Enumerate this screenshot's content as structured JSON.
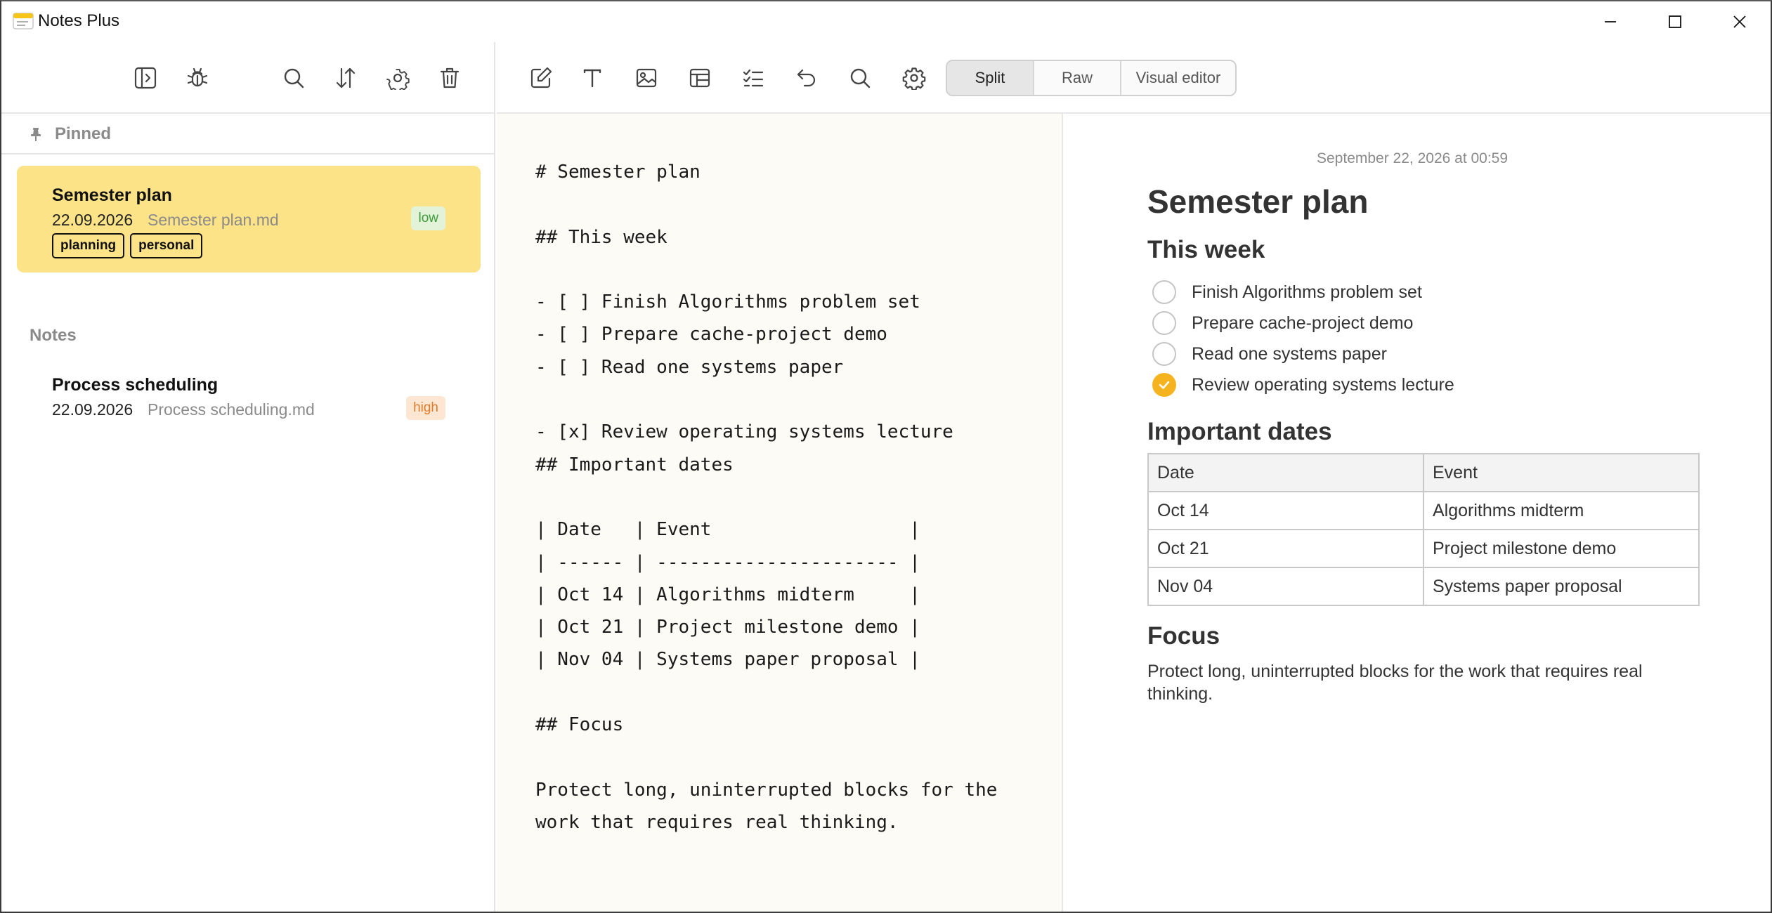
{
  "window": {
    "title": "Notes Plus",
    "controls": {
      "minimize_icon": "minimize-icon",
      "maximize_icon": "maximize-icon",
      "close_icon": "close-icon"
    }
  },
  "sidebar": {
    "toolbar_icons": [
      "toggle-sidebar-icon",
      "bug-icon",
      "search-icon",
      "sort-icon",
      "settings-icon",
      "trash-icon"
    ],
    "pinned_label": "Pinned",
    "pinned_notes": [
      {
        "title": "Semester plan",
        "date": "22.09.2026",
        "file": "Semester plan.md",
        "priority": "low",
        "tags": [
          "planning",
          "personal"
        ]
      }
    ],
    "notes_label": "Notes",
    "notes": [
      {
        "title": "Process scheduling",
        "date": "22.09.2026",
        "file": "Process scheduling.md",
        "priority": "high"
      }
    ]
  },
  "editor": {
    "toolbar_icons": [
      "edit-icon",
      "text-icon",
      "image-icon",
      "table-icon",
      "checklist-icon",
      "undo-icon",
      "search-icon",
      "settings-icon"
    ],
    "modes": [
      "Split",
      "Raw",
      "Visual editor"
    ],
    "active_mode": "Split",
    "raw_lines": [
      "# Semester plan",
      "",
      "## This week",
      "",
      "- [ ] Finish Algorithms problem set",
      "- [ ] Prepare cache-project demo",
      "- [ ] Read one systems paper",
      "",
      "- [x] Review operating systems lecture",
      "## Important dates",
      "",
      "| Date   | Event                  |",
      "| ------ | ---------------------- |",
      "| Oct 14 | Algorithms midterm     |",
      "| Oct 21 | Project milestone demo |",
      "| Nov 04 | Systems paper proposal |",
      "",
      "## Focus",
      "",
      "Protect long, uninterrupted blocks for the",
      "work that requires real thinking."
    ]
  },
  "preview": {
    "timestamp": "September 22, 2026 at 00:59",
    "title": "Semester plan",
    "week_heading": "This week",
    "tasks": [
      {
        "text": "Finish Algorithms problem set",
        "done": false
      },
      {
        "text": "Prepare cache-project demo",
        "done": false
      },
      {
        "text": "Read one systems paper",
        "done": false
      },
      {
        "text": "Review operating systems lecture",
        "done": true
      }
    ],
    "dates_heading": "Important dates",
    "table": {
      "headers": [
        "Date",
        "Event"
      ],
      "rows": [
        [
          "Oct 14",
          "Algorithms midterm"
        ],
        [
          "Oct 21",
          "Project milestone demo"
        ],
        [
          "Nov 04",
          "Systems paper proposal"
        ]
      ]
    },
    "focus_heading": "Focus",
    "focus_text": "Protect long, uninterrupted blocks for the work that requires real thinking."
  },
  "colors": {
    "accent_yellow": "#fde387",
    "checkbox_done": "#f5b320",
    "priority_low_bg": "#e3f3d9",
    "priority_low_fg": "#3d9b3a",
    "priority_high_bg": "#fde6d2",
    "priority_high_fg": "#e07b2a",
    "editor_bg": "#fdfbf6"
  }
}
